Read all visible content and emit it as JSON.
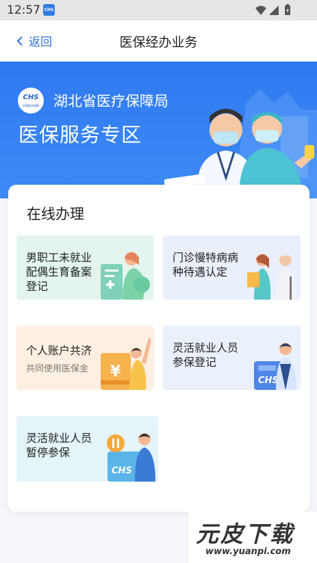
{
  "status_bar": {
    "time": "12:57",
    "app_icon_text": "CHS"
  },
  "navbar": {
    "back_label": "返回",
    "title": "医保经办业务"
  },
  "banner": {
    "logo_text": "CHS",
    "logo_sub": "中国医疗保障",
    "agency": "湖北省医疗保障局",
    "zone": "医保服务专区"
  },
  "online": {
    "title": "在线办理",
    "services": [
      {
        "label": "男职工未就业\n配偶生育备案\n登记",
        "bg": "#e3f5ee"
      },
      {
        "label": "门诊慢特病病\n种待遇认定",
        "bg": "#e9f0fb"
      },
      {
        "label": "个人账户共济",
        "sub": "共同使用医保金",
        "bg": "#fdf0e2"
      },
      {
        "label": "灵活就业人员\n参保登记",
        "bg": "#eaf1fc"
      },
      {
        "label": "灵活就业人员\n暂停参保",
        "bg": "#e4f4f8"
      }
    ]
  },
  "watermark": {
    "main": "元皮下载",
    "url": "www.yuanpi.com"
  }
}
